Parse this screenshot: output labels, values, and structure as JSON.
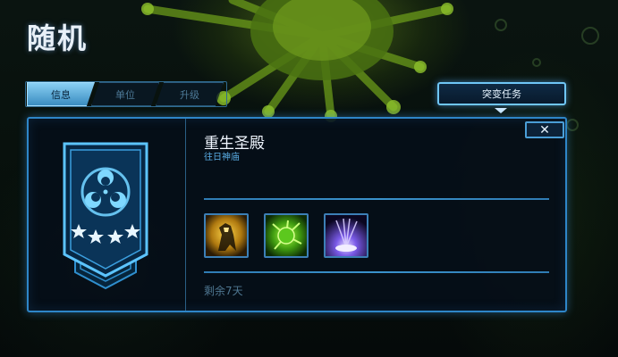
{
  "page": {
    "title": "随机"
  },
  "tabs": [
    {
      "label": "信息",
      "active": true
    },
    {
      "label": "单位",
      "active": false
    },
    {
      "label": "升级",
      "active": false
    }
  ],
  "mutation_button": {
    "label": "突变任务"
  },
  "close_button": {
    "label": "✕"
  },
  "mission": {
    "map_name": "重生圣殿",
    "subtitle": "往日神庙",
    "difficulty_stars": 4,
    "remaining": "剩余7天"
  },
  "mutators": [
    {
      "icon": "mutator-warrior-icon"
    },
    {
      "icon": "mutator-virus-icon"
    },
    {
      "icon": "mutator-energy-burst-icon"
    }
  ],
  "colors": {
    "accent": "#2e86c8",
    "tab_active": "#6ab8e8",
    "subtitle": "#5aaee6",
    "emblem": "#6fd0ff"
  }
}
